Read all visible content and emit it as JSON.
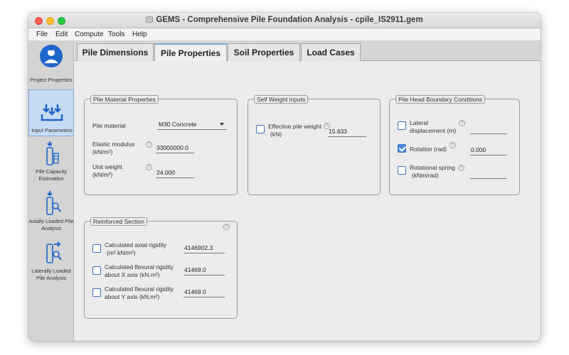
{
  "window": {
    "title": "GEMS - Comprehensive Pile Foundation Analysis - cpile_IS2911.gem"
  },
  "menu": [
    "File",
    "Edit",
    "Compute",
    "Tools",
    "Help"
  ],
  "sidebar": {
    "items": [
      {
        "label": "Project Properties",
        "icon": "user-avatar-icon"
      },
      {
        "label": "Input Parameters",
        "icon": "download-arrows-icon"
      },
      {
        "label": "Pile Capacity Estimation",
        "icon": "pile-arrow-icon"
      },
      {
        "label": "Axially Loaded Pile Analysis",
        "icon": "pile-magnifier-icon"
      },
      {
        "label": "Laterally Loaded Pile Analysis",
        "icon": "pile-lateral-arrow-icon"
      }
    ]
  },
  "tabs": [
    "Pile Dimensions",
    "Pile Properties",
    "Soil Properties",
    "Load Cases"
  ],
  "pile_material": {
    "legend": "Pile Material Properties",
    "material_label": "Pile material",
    "material_value": "M30 Concrete",
    "elastic_label_1": "Elastic modulus",
    "elastic_label_2": "(kN/m²)",
    "elastic_value": "33000000.0",
    "unit_label_1": "Unit weight",
    "unit_label_2": "(kN/m³)",
    "unit_value": "24.000"
  },
  "self_weight": {
    "legend": "Self Weight inputs",
    "label_1": "Effective pile weight",
    "label_2": "(kN)",
    "value": "15.633",
    "checked": false
  },
  "pile_head": {
    "legend": "Pile Head Boundary Conditions",
    "lateral_label_1": "Lateral",
    "lateral_label_2": "displacement (m)",
    "lateral_value": "",
    "rotation_label": "Rotation (rad)",
    "rotation_value": "0.000",
    "spring_label_1": "Rotational spring",
    "spring_label_2": "(kNm/rad)",
    "spring_value": ""
  },
  "reinforced": {
    "legend": "Reinforced Section",
    "axial_label_1": "Calculated axial rigidity",
    "axial_label_2": "(m².kN/m²)",
    "axial_value": "4146902.3",
    "flexx_label_1": "Calculated flexural rigidity",
    "flexx_label_2": "about X axis (kN.m²)",
    "flexx_value": "41469.0",
    "flexy_label_1": "Calculated flexural rigidity",
    "flexy_label_2": "about Y axis (kN.m²)",
    "flexy_value": "41469.0"
  },
  "colors": {
    "accent": "#4a89dc",
    "selected_nav": "#c7dcf4"
  },
  "help_glyph": "?"
}
